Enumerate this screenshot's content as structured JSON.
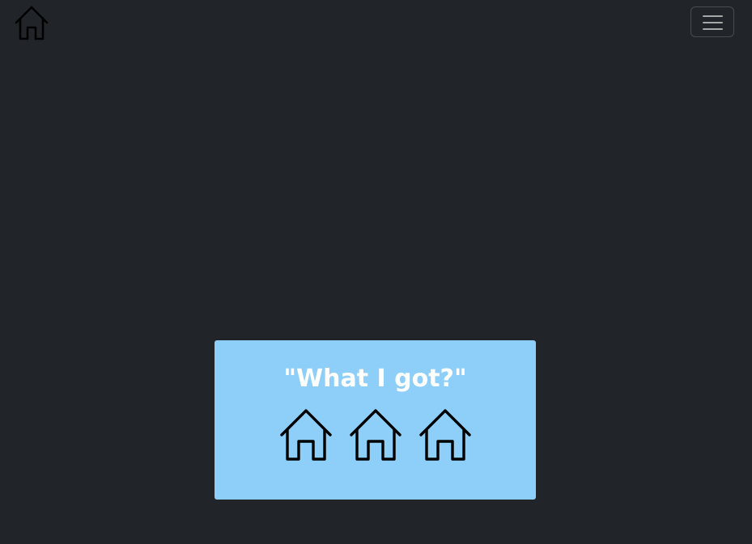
{
  "navbar": {
    "home_icon": "house-icon",
    "menu_icon": "hamburger-menu-icon"
  },
  "card": {
    "title": "\"What I got?\"",
    "background_color": "#8ecff9",
    "icons": [
      "house-icon",
      "house-icon",
      "house-icon"
    ]
  },
  "colors": {
    "page_background": "#212529",
    "title_text": "#ffffff"
  }
}
